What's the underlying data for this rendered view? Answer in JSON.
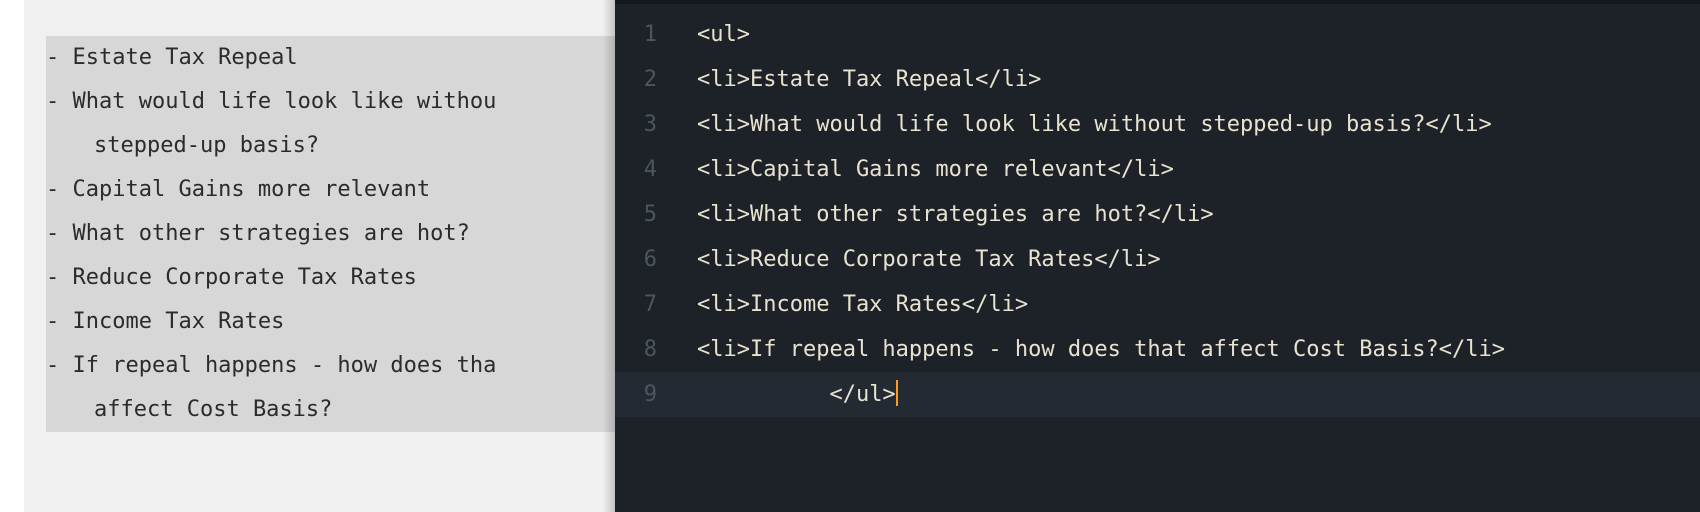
{
  "left": {
    "items": [
      "Estate Tax Repeal",
      "What would life look like without stepped-up basis?",
      "Capital Gains more relevant",
      "What other strategies are hot?",
      "Reduce Corporate Tax Rates",
      "Income Tax Rates",
      "If repeal happens - how does that affect Cost Basis?"
    ],
    "rendered_lines": [
      {
        "text": "- Estate Tax Repeal",
        "wrap": false
      },
      {
        "text": "- What would life look like withou",
        "wrap": false
      },
      {
        "text": "stepped-up basis?",
        "wrap": true
      },
      {
        "text": "- Capital Gains more relevant",
        "wrap": false
      },
      {
        "text": "- What other strategies are hot?",
        "wrap": false
      },
      {
        "text": "- Reduce Corporate Tax Rates",
        "wrap": false
      },
      {
        "text": "- Income Tax Rates",
        "wrap": false
      },
      {
        "text": "- If repeal happens - how does tha",
        "wrap": false
      },
      {
        "text": "affect Cost Basis?",
        "wrap": true
      }
    ]
  },
  "right": {
    "lines": [
      {
        "n": 1,
        "text": "<ul>"
      },
      {
        "n": 2,
        "text": "<li>Estate Tax Repeal</li>"
      },
      {
        "n": 3,
        "text": "<li>What would life look like without stepped-up basis?</li>"
      },
      {
        "n": 4,
        "text": "<li>Capital Gains more relevant</li>"
      },
      {
        "n": 5,
        "text": "<li>What other strategies are hot?</li>"
      },
      {
        "n": 6,
        "text": "<li>Reduce Corporate Tax Rates</li>"
      },
      {
        "n": 7,
        "text": "<li>Income Tax Rates</li>"
      },
      {
        "n": 8,
        "text": "<li>If repeal happens - how does that affect Cost Basis?</li>"
      },
      {
        "n": 9,
        "text": "</ul>"
      }
    ],
    "current_line": 9,
    "cursor_after": true
  }
}
